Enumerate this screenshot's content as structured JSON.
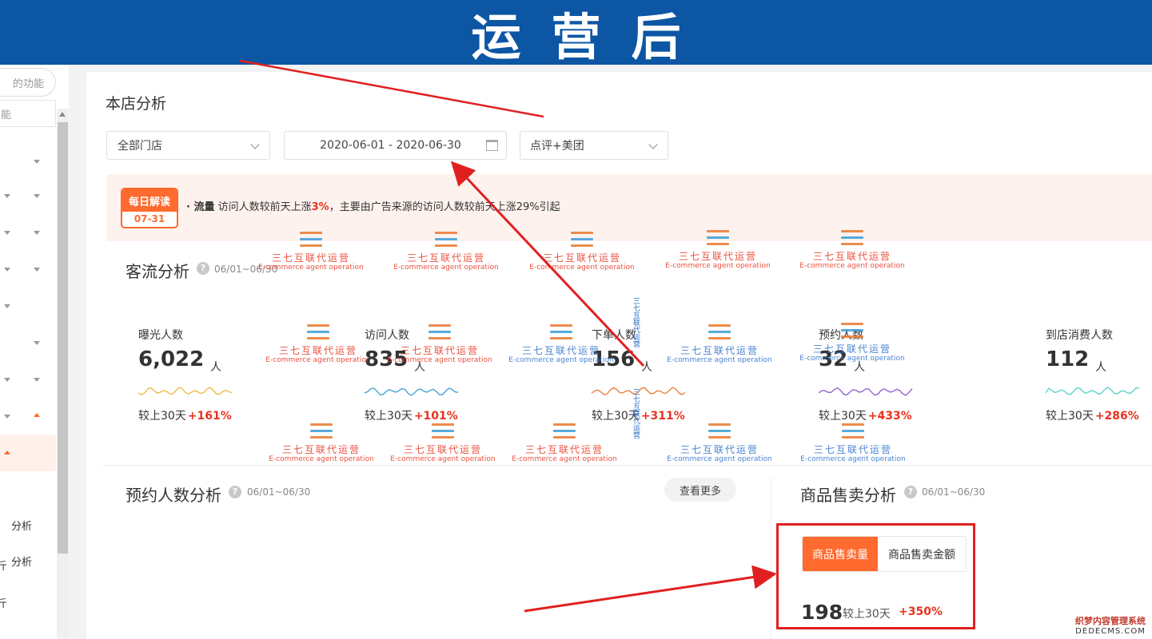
{
  "banner": {
    "title": "运营后"
  },
  "sidebar": {
    "top_button": "的功能",
    "search_hint": "能",
    "items": [
      {
        "label": "分析"
      },
      {
        "label": "分析"
      },
      {
        "label": "斤"
      },
      {
        "label": "斤"
      }
    ]
  },
  "page": {
    "title": "本店分析"
  },
  "filters": {
    "store": "全部门店",
    "date_range": "2020-06-01 - 2020-06-30",
    "platform": "点评+美团"
  },
  "daily": {
    "badge_title": "每日解读",
    "badge_date": "07-31",
    "prefix": "· 流量",
    "text_a": "访问人数较前天上涨",
    "pct": "3%",
    "text_b": "，主要由广告来源的访问人数较前天上涨29%引起"
  },
  "traffic": {
    "title": "客流分析",
    "help": "?",
    "date": "06/01~06/30",
    "compare_label": "较上30天",
    "metrics": [
      {
        "label": "曝光人数",
        "value": "6,022",
        "unit": "人",
        "change": "+161%",
        "color": "#f0b63c"
      },
      {
        "label": "访问人数",
        "value": "835",
        "unit": "人",
        "change": "+101%",
        "color": "#3a9ed8"
      },
      {
        "label": "下单人数",
        "value": "156",
        "unit": "人",
        "change": "+311%",
        "color": "#e8792e"
      },
      {
        "label": "预约人数",
        "value": "32",
        "unit": "人",
        "change": "+433%",
        "color": "#8a5cd0"
      },
      {
        "label": "到店消费人数",
        "value": "112",
        "unit": "人",
        "change": "+286%",
        "color": "#4fd3c4"
      }
    ]
  },
  "booking": {
    "title": "预约人数分析",
    "help": "?",
    "date": "06/01~06/30",
    "more_label": "查看更多"
  },
  "sales": {
    "title": "商品售卖分析",
    "help": "?",
    "date": "06/01~06/30",
    "tab_active": "商品售卖量",
    "tab_other": "商品售卖金额",
    "value": "198",
    "compare_label": "较上30天",
    "change": "+350%"
  },
  "watermark": {
    "cn": "三七互联代运营",
    "en": "E-commerce agent operation"
  },
  "corner": {
    "line1": "织梦内容管理系统",
    "line2": "DEDECMS.COM"
  },
  "colors": {
    "banner": "#0c56a4",
    "accent": "#ff6a2e",
    "up_red": "#e8331e",
    "arrow": "#e02020"
  }
}
